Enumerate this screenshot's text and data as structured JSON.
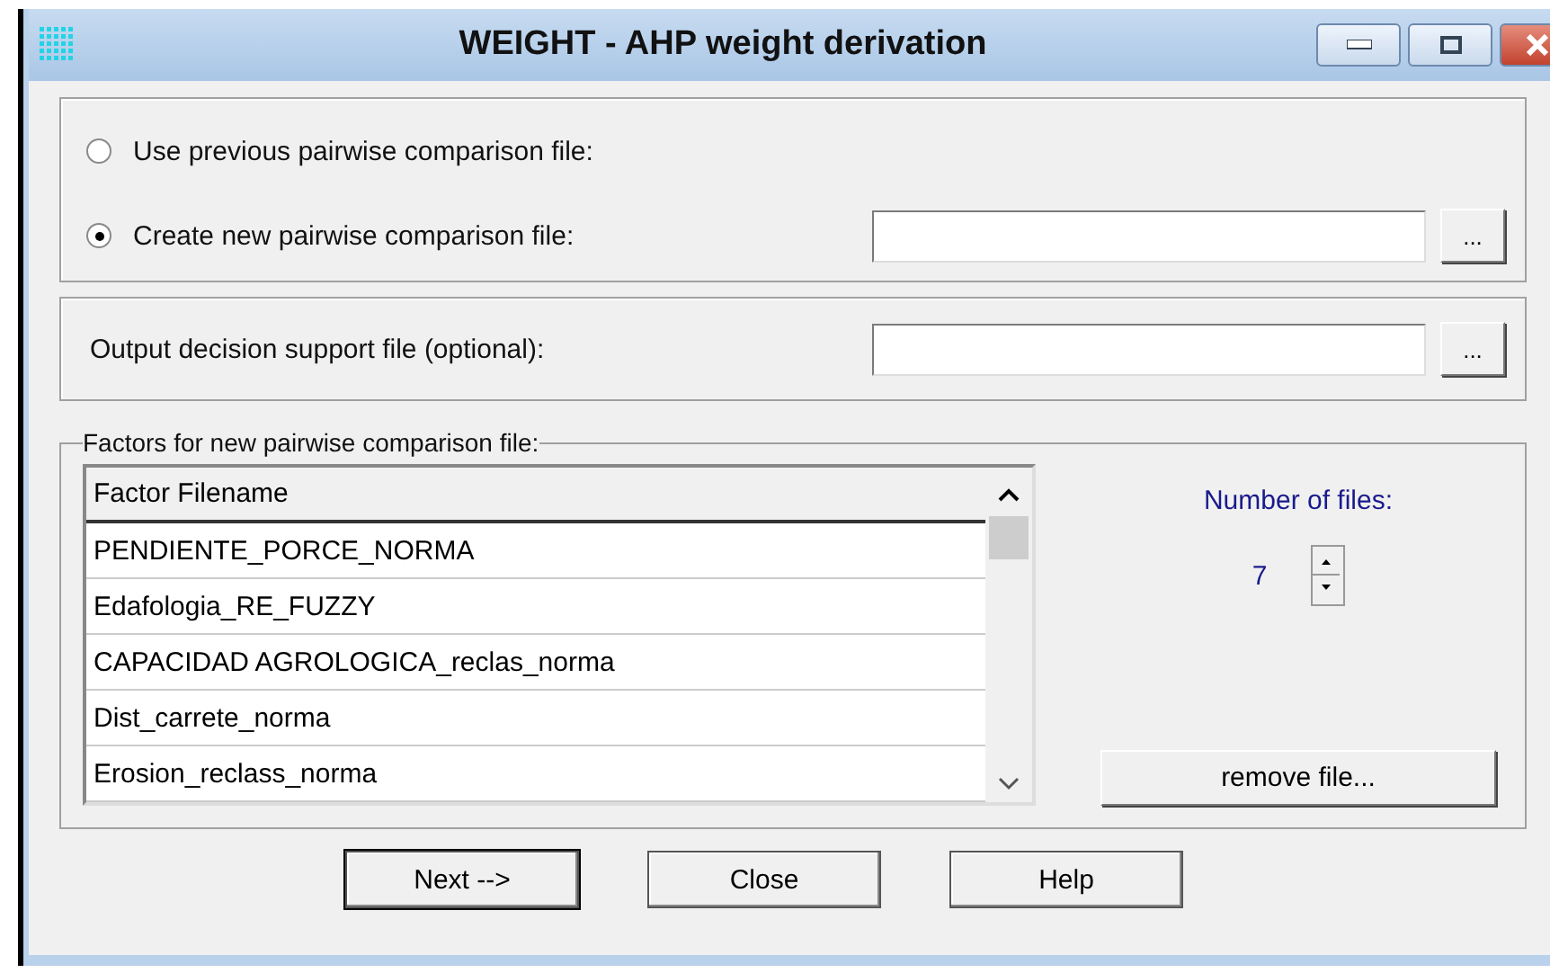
{
  "window": {
    "title": "WEIGHT - AHP weight derivation"
  },
  "source_options": [
    {
      "label": "Use previous pairwise comparison file:",
      "selected": false
    },
    {
      "label": "Create new pairwise comparison file:",
      "selected": true,
      "browse": "..."
    }
  ],
  "output": {
    "label": "Output decision support file (optional):",
    "browse": "..."
  },
  "factors": {
    "legend": "Factors for new pairwise comparison file:",
    "column": "Factor Filename",
    "rows": [
      "PENDIENTE_PORCE_NORMA",
      "Edafologia_RE_FUZZY",
      "CAPACIDAD AGROLOGICA_reclas_norma",
      "Dist_carrete_norma",
      "Erosion_reclass_norma"
    ],
    "count_label": "Number of files:",
    "count": "7",
    "remove": "remove file..."
  },
  "buttons": [
    "Next -->",
    "Close",
    "Help"
  ]
}
